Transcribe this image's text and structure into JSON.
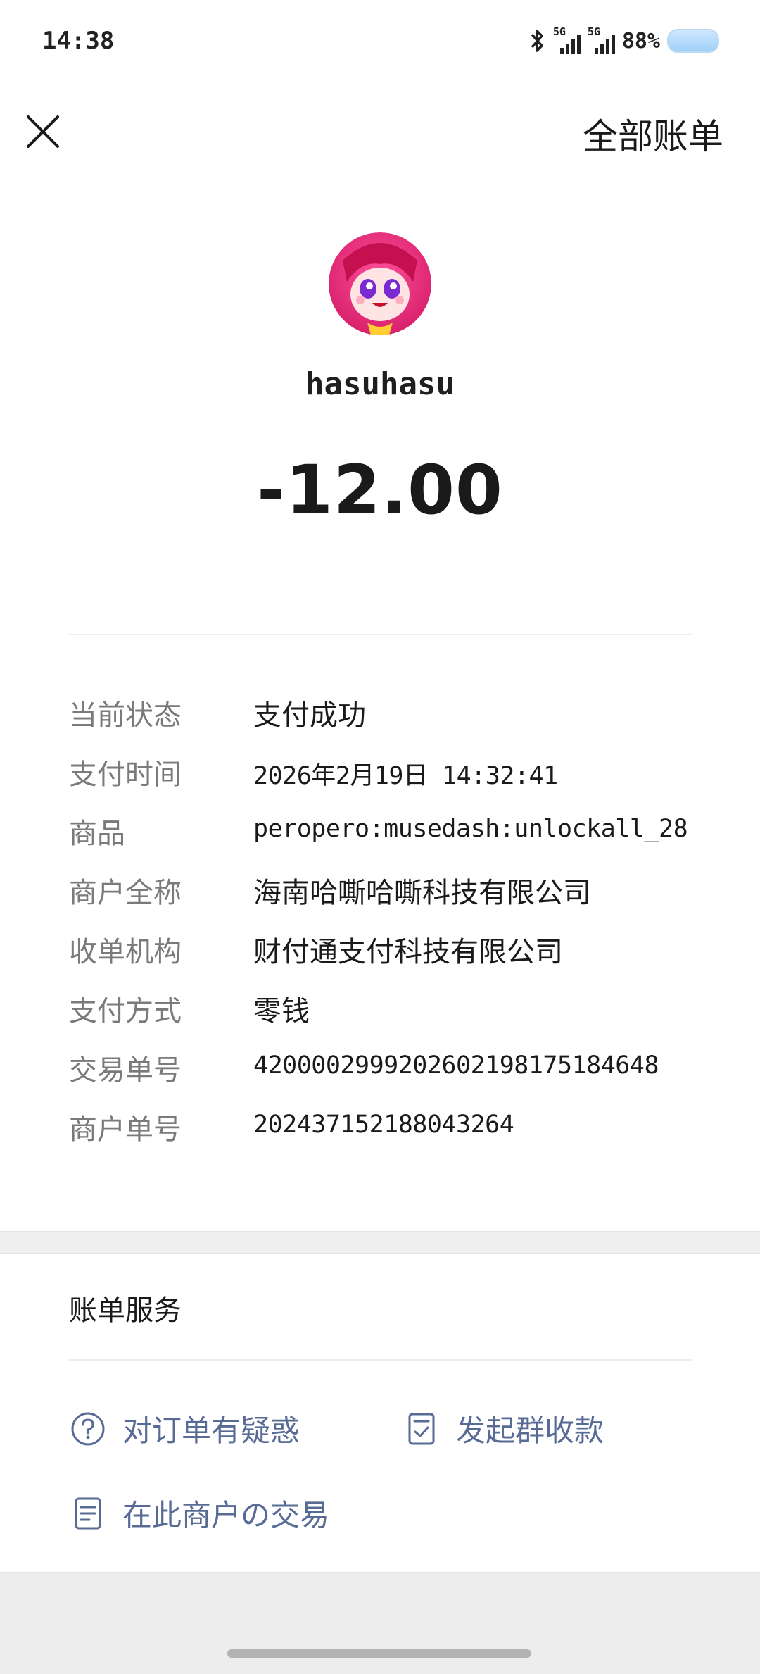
{
  "status_bar": {
    "time": "14:38",
    "network_1": "5G",
    "network_2": "5G",
    "battery_pct": "88%",
    "icons": [
      "bluetooth-icon",
      "signal-icon",
      "signal-icon",
      "battery-icon"
    ]
  },
  "header": {
    "close_icon": "close-icon",
    "all_bills_label": "全部账单"
  },
  "merchant": {
    "avatar_icon": "merchant-avatar",
    "name": "hasuhasu"
  },
  "amount": "-12.00",
  "details": [
    {
      "label": "当前状态",
      "value": "支付成功"
    },
    {
      "label": "支付时间",
      "value": "2026年2月19日 14:32:41"
    },
    {
      "label": "商品",
      "value": "peropero:musedash:unlockall_28"
    },
    {
      "label": "商户全称",
      "value": "海南哈嘶哈嘶科技有限公司"
    },
    {
      "label": "收单机构",
      "value": "财付通支付科技有限公司"
    },
    {
      "label": "支付方式",
      "value": "零钱"
    },
    {
      "label": "交易单号",
      "value": "4200002999202602198175184648"
    },
    {
      "label": "商户单号",
      "value": "202437152188043264"
    }
  ],
  "services": {
    "title": "账单服务",
    "items": [
      {
        "icon": "question-circle-icon",
        "label": "对订单有疑惑"
      },
      {
        "icon": "split-bill-icon",
        "label": "发起群收款"
      },
      {
        "icon": "document-icon",
        "label": "在此商户の交易"
      }
    ]
  },
  "colors": {
    "link": "#576b95",
    "label": "#7a7a7a",
    "text": "#1a1a1a"
  }
}
